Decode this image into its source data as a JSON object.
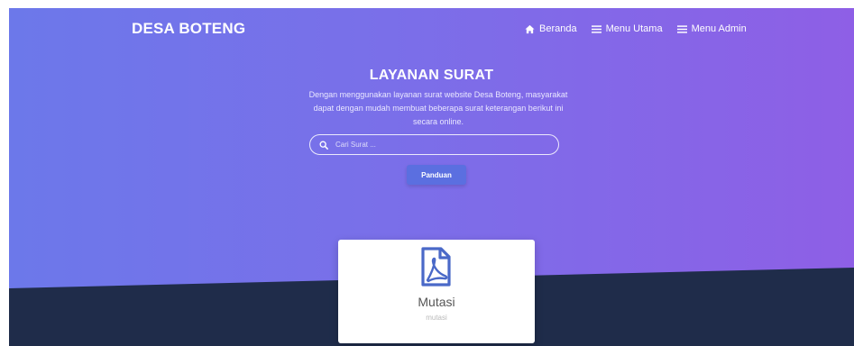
{
  "brand": "DESA BOTENG",
  "nav": {
    "items": [
      {
        "icon": "home-icon",
        "label": "Beranda"
      },
      {
        "icon": "menu-icon",
        "label": "Menu Utama"
      },
      {
        "icon": "menu-icon",
        "label": "Menu Admin"
      }
    ]
  },
  "hero": {
    "title": "LAYANAN SURAT",
    "subtitle": "Dengan menggunakan layanan surat website Desa Boteng, masyarakat dapat dengan mudah membuat beberapa surat keterangan berikut ini secara online."
  },
  "search": {
    "placeholder": "Cari Surat ...",
    "value": ""
  },
  "guide_button": "Panduan",
  "card": {
    "icon": "pdf-file-icon",
    "title": "Mutasi",
    "subtitle": "mutasi"
  },
  "colors": {
    "gradient_start": "#6c78ea",
    "gradient_end": "#8e5fe6",
    "dark_band": "#1f2c4a",
    "button": "#5b6fe0"
  }
}
